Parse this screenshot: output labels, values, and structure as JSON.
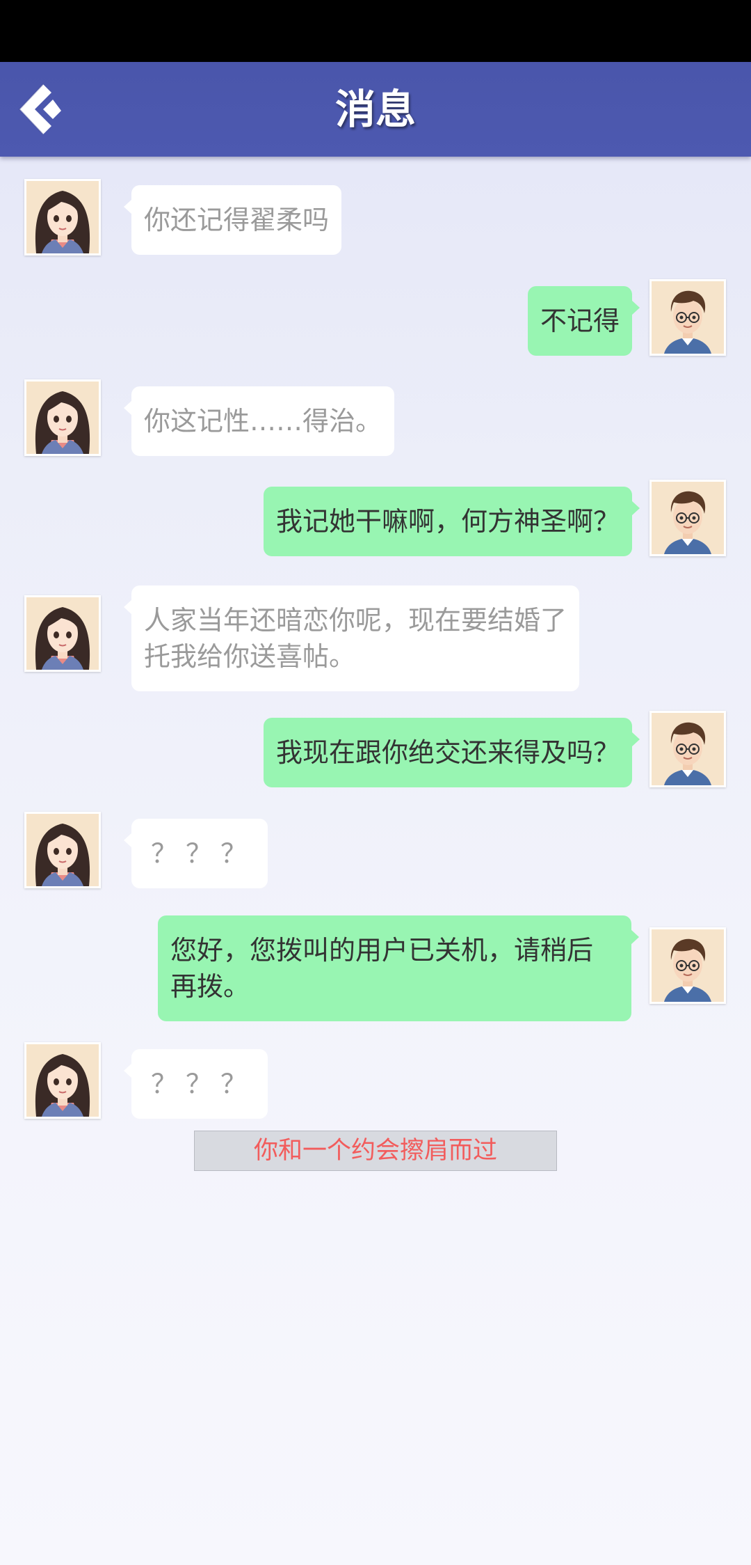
{
  "header": {
    "title": "消息",
    "back_icon": "back-arrow-icon"
  },
  "colors": {
    "header_bg": "#4b57ad",
    "outgoing_bubble": "#98f5b2",
    "incoming_bubble": "#ffffff",
    "incoming_text": "#9a9a9a",
    "outgoing_text": "#333333",
    "system_text": "#f25c5c"
  },
  "messages": [
    {
      "sender": "girl",
      "text": "你还记得翟柔吗"
    },
    {
      "sender": "me",
      "text": "不记得"
    },
    {
      "sender": "girl",
      "text": "你这记性……得治。"
    },
    {
      "sender": "me",
      "text": "我记她干嘛啊，何方神圣啊？"
    },
    {
      "sender": "girl",
      "text": "人家当年还暗恋你呢，现在要结婚了\n托我给你送喜帖。"
    },
    {
      "sender": "me",
      "text": "我现在跟你绝交还来得及吗？"
    },
    {
      "sender": "girl",
      "text": "？？？"
    },
    {
      "sender": "me",
      "text": "您好，您拨叫的用户已关机，请稍后\n再拨。"
    },
    {
      "sender": "girl",
      "text": "？？？"
    }
  ],
  "system_note": "你和一个约会擦肩而过"
}
